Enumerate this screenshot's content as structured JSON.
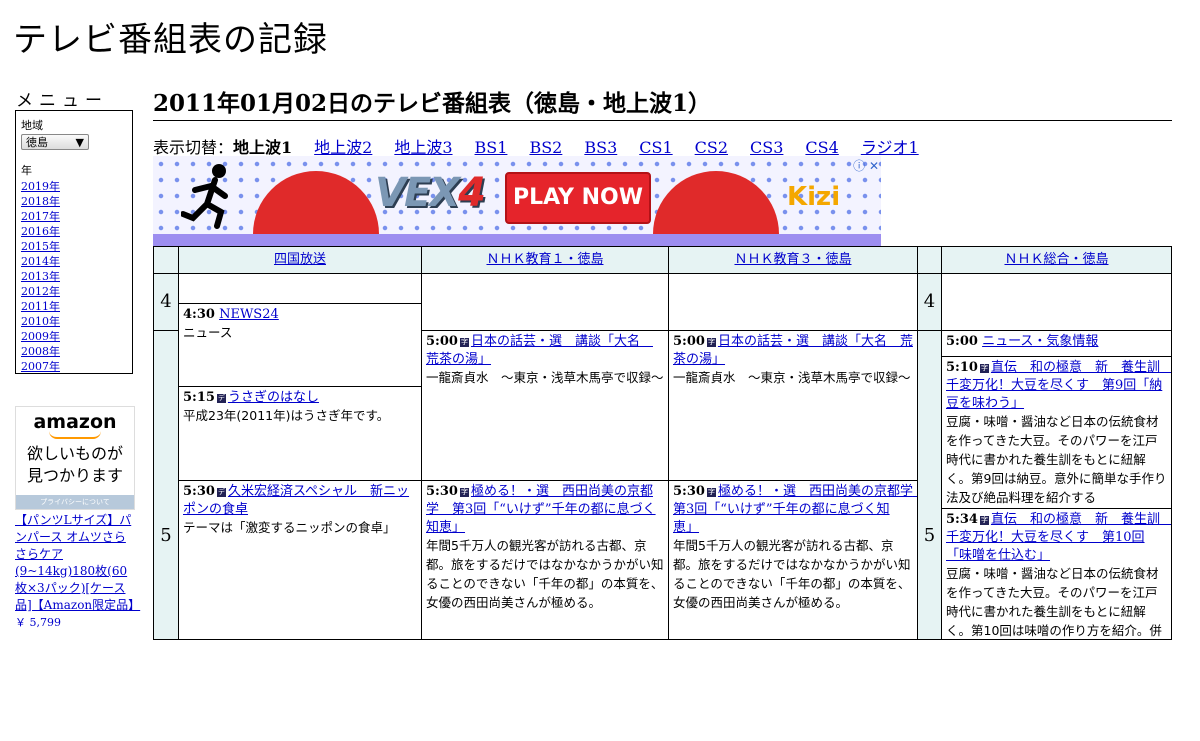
{
  "site": {
    "title": "テレビ番組表の記録"
  },
  "sidebar": {
    "menu_title": "メニュー",
    "region_label": "地域",
    "region_value": "徳島",
    "year_label": "年",
    "years": [
      "2019年",
      "2018年",
      "2017年",
      "2016年",
      "2015年",
      "2014年",
      "2013年",
      "2012年",
      "2011年",
      "2010年",
      "2009年",
      "2008年",
      "2007年"
    ]
  },
  "amazon_ad": {
    "logo": "amazon",
    "tagline_1": "欲しいものが",
    "tagline_2": "見つかります",
    "privacy": "プライバシーについて",
    "product": "【パンツLサイズ】パンパース オムツさらさらケア (9~14kg)180枚(60枚×3パック)[ケース品]【Amazon限定品】",
    "price": "￥ 5,799"
  },
  "main": {
    "title": "2011年01月02日のテレビ番組表（徳島・地上波1）",
    "switch_label": "表示切替：",
    "switch_current": "地上波1",
    "switch_links": [
      "地上波2",
      "地上波3",
      "BS1",
      "BS2",
      "BS3",
      "CS1",
      "CS2",
      "CS3",
      "CS4",
      "ラジオ1"
    ]
  },
  "banner": {
    "logo_a": "VEX",
    "logo_b": "4",
    "play": "PLAY NOW",
    "brand": "Kizi",
    "ad_icons": "ⓘ ✕"
  },
  "schedule": {
    "channels": [
      "四国放送",
      "ＮＨＫ教育１・徳島",
      "ＮＨＫ教育３・徳島",
      "ＮＨＫ総合・徳島"
    ],
    "hours": [
      "4",
      "5"
    ],
    "programs": {
      "shikoku_1": {
        "time": "4:30",
        "title": "NEWS24",
        "desc": "ニュース"
      },
      "shikoku_2": {
        "time": "5:15",
        "title": "うさぎのはなし",
        "desc": "平成23年(2011年)はうさぎ年です。"
      },
      "shikoku_3": {
        "time": "5:30",
        "title": "久米宏経済スペシャル　新ニッポンの食卓",
        "desc": "テーマは「激変するニッポンの食卓」"
      },
      "edu1_1": {
        "time": "5:00",
        "title": "日本の話芸・選　講談「大名　荒茶の湯」",
        "desc": "一龍斎貞水　～東京・浅草木馬亭で収録～"
      },
      "edu1_2": {
        "time": "5:30",
        "title": "極める！・選　西田尚美の京都学　第3回「“いけず”千年の都に息づく知恵」",
        "desc": "年間5千万人の観光客が訪れる古都、京都。旅をするだけではなかなかうかがい知ることのできない「千年の都」の本質を、女優の西田尚美さんが極める。"
      },
      "edu3_1": {
        "time": "5:00",
        "title": "日本の話芸・選　講談「大名　荒茶の湯」",
        "desc": "一龍斎貞水　～東京・浅草木馬亭で収録～"
      },
      "edu3_2": {
        "time": "5:30",
        "title": "極める！・選　西田尚美の京都学　第3回「“いけず”千年の都に息づく知恵」",
        "desc": "年間5千万人の観光客が訪れる古都、京都。旅をするだけではなかなかうかがい知ることのできない「千年の都」の本質を、女優の西田尚美さんが極める。"
      },
      "gen_1": {
        "time": "5:00",
        "title": "ニュース・気象情報",
        "desc": ""
      },
      "gen_2": {
        "time": "5:10",
        "title": "直伝　和の極意　新　養生訓　千変万化！大豆を尽くす　第9回「納豆を味わう」",
        "desc": "豆腐・味噌・醤油など日本の伝統食材を作ってきた大豆。そのパワーを江戸時代に書かれた養生訓をもとに紐解く。第9回は納豆。意外に簡単な手作り法及び絶品料理を紹介する"
      },
      "gen_3": {
        "time": "5:34",
        "title": "直伝　和の極意　新　養生訓　千変万化！大豆を尽くす　第10回「味噌を仕込む」",
        "desc": "豆腐・味噌・醤油など日本の伝統食材を作ってきた大豆。そのパワーを江戸時代に書かれた養生訓をもとに紐解く。第10回は味噌の作り方を紹介。併"
      }
    }
  }
}
